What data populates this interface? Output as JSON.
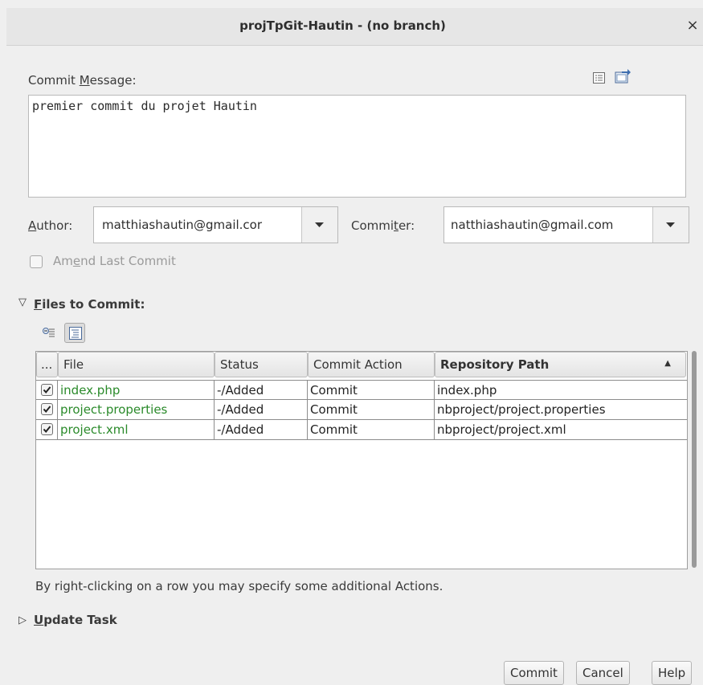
{
  "window": {
    "title": "projTpGit-Hautin - (no branch)",
    "close_glyph": "×"
  },
  "commit_message": {
    "label_pre": "Commit ",
    "label_u": "M",
    "label_post": "essage:",
    "value": "premier commit du projet Hautin",
    "icons": [
      "recent-messages-icon",
      "load-template-icon"
    ]
  },
  "author": {
    "label_u": "A",
    "label_post": "uthor:",
    "value": "matthiashautin@gmail.cor"
  },
  "committer": {
    "label_pre": "Commi",
    "label_u": "t",
    "label_post": "er:",
    "value": "natthiashautin@gmail.com"
  },
  "amend": {
    "label_pre": "Am",
    "label_u": "e",
    "label_post": "nd Last Commit",
    "checked": false
  },
  "files_section": {
    "toggle_glyph": "▽",
    "label_u": "F",
    "label_post": "iles to Commit:",
    "toolbar_icons": [
      "collapse-tree-icon",
      "expand-tree-icon"
    ],
    "columns": [
      "...",
      "File",
      "Status",
      "Commit Action",
      "Repository Path"
    ],
    "sort_glyph": "▲",
    "rows": [
      {
        "checked": true,
        "file": "index.php",
        "status": "-/Added",
        "action": "Commit",
        "path": "index.php"
      },
      {
        "checked": true,
        "file": "project.properties",
        "status": "-/Added",
        "action": "Commit",
        "path": "nbproject/project.properties"
      },
      {
        "checked": true,
        "file": "project.xml",
        "status": "-/Added",
        "action": "Commit",
        "path": "nbproject/project.xml"
      }
    ],
    "hint": "By right-clicking on a row you may specify some additional Actions."
  },
  "update_task": {
    "toggle_glyph": "▷",
    "label_u": "U",
    "label_post": "pdate Task"
  },
  "buttons": {
    "commit": "Commit",
    "cancel": "Cancel",
    "help": "Help"
  },
  "colors": {
    "added_file": "#2a8a2a",
    "background": "#efefef"
  }
}
